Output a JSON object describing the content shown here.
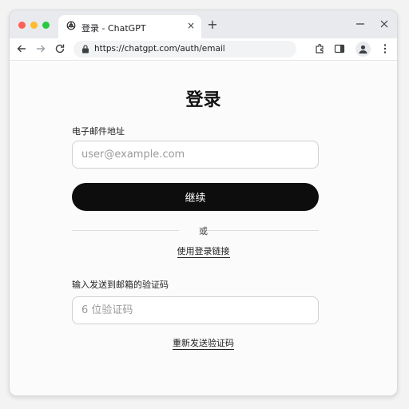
{
  "browser": {
    "tab_title": "登录 - ChatGPT",
    "tab_icon": "openai-logo-icon",
    "new_tab_label": "+",
    "close_tab_label": "×",
    "url": "https://chatgpt.com/auth/email"
  },
  "page": {
    "title": "登录",
    "email_label": "电子邮件地址",
    "email_placeholder": "user@example.com",
    "email_value": "",
    "continue_label": "继续",
    "divider_text": "或",
    "login_link_label": "使用登录链接",
    "code_label": "输入发送到邮箱的验证码",
    "code_placeholder": "6 位验证码",
    "code_value": "",
    "resend_label": "重新发送验证码"
  },
  "colors": {
    "primary_button": "#0d0d0d",
    "window_bg": "#ffffff",
    "tabstrip_bg": "#e8eaed"
  }
}
